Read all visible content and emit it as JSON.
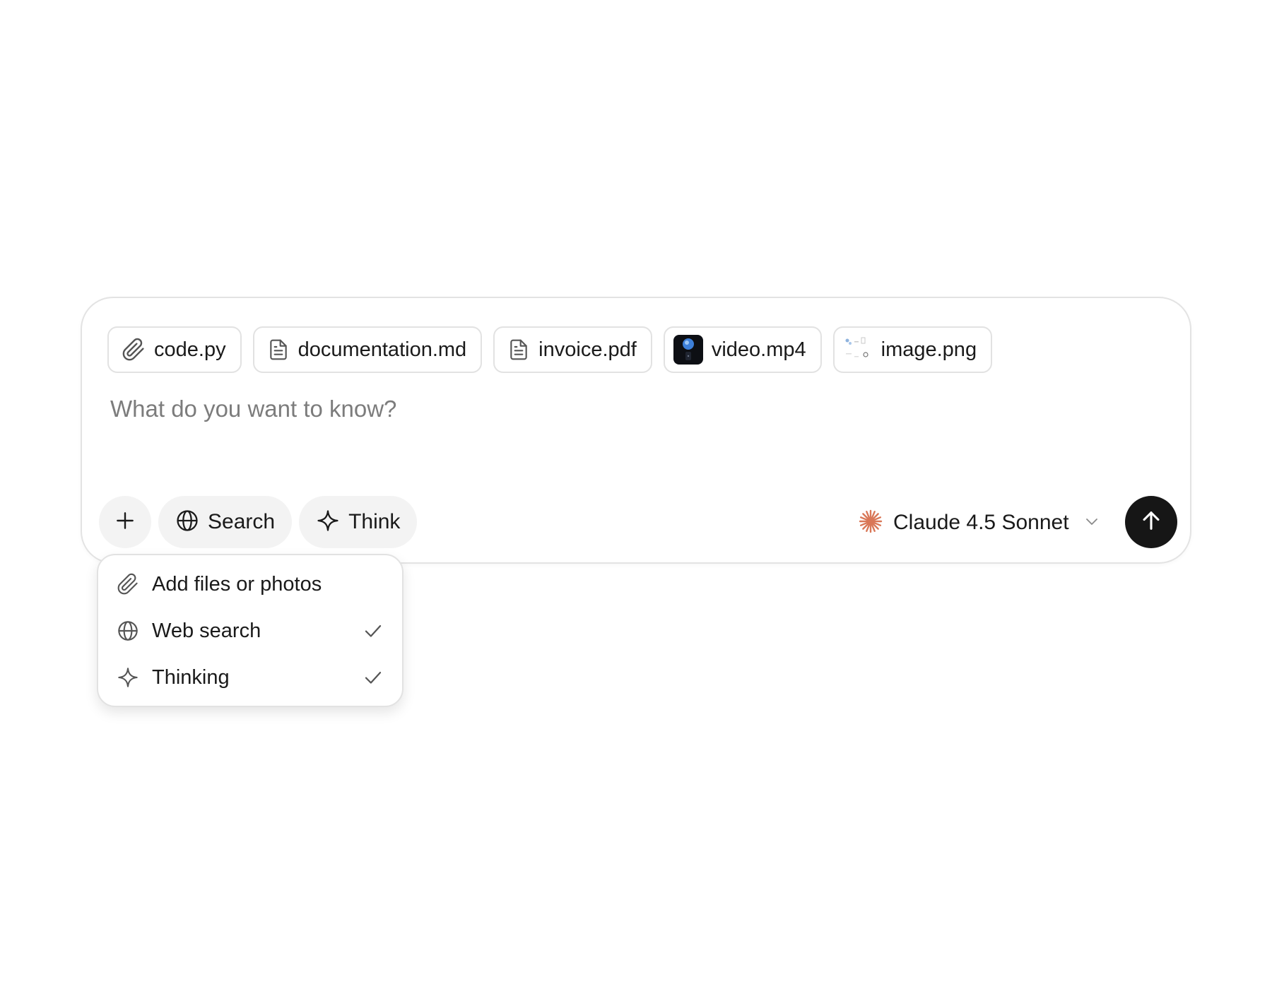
{
  "attachments": [
    {
      "name": "code.py",
      "icon": "paperclip-icon"
    },
    {
      "name": "documentation.md",
      "icon": "file-icon"
    },
    {
      "name": "invoice.pdf",
      "icon": "file-icon"
    },
    {
      "name": "video.mp4",
      "icon": "video-thumbnail"
    },
    {
      "name": "image.png",
      "icon": "image-thumbnail"
    }
  ],
  "prompt": {
    "value": "",
    "placeholder": "What do you want to know?"
  },
  "toolbar": {
    "add_icon": "plus-icon",
    "search_label": "Search",
    "search_icon": "globe-icon",
    "think_label": "Think",
    "think_icon": "sparkle-icon"
  },
  "model": {
    "label": "Claude 4.5 Sonnet",
    "icon": "claude-logo-icon",
    "accent": "#d97757"
  },
  "send": {
    "icon": "arrow-up-icon",
    "color": "#161616"
  },
  "menu": {
    "items": [
      {
        "label": "Add files or photos",
        "icon": "paperclip-icon",
        "checked": false
      },
      {
        "label": "Web search",
        "icon": "globe-icon",
        "checked": true
      },
      {
        "label": "Thinking",
        "icon": "sparkle-icon",
        "checked": true
      }
    ]
  }
}
